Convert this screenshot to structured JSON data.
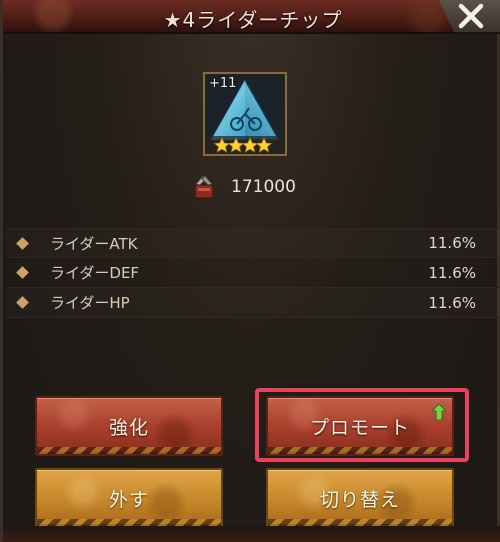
{
  "dialog": {
    "title": "★4ライダーチップ",
    "close_icon": "close-x-icon"
  },
  "item": {
    "level_badge": "+11",
    "stars": 4,
    "icon": "triangle-chip-icon"
  },
  "cost": {
    "icon": "parts-icon",
    "value": "171000"
  },
  "stats": [
    {
      "label": "ライダーATK",
      "value": "11.6%"
    },
    {
      "label": "ライダーDEF",
      "value": "11.6%"
    },
    {
      "label": "ライダーHP",
      "value": "11.6%"
    }
  ],
  "buttons": {
    "enhance": "強化",
    "promote": "プロモート",
    "remove": "外す",
    "switch": "切り替え"
  },
  "colors": {
    "highlight": "#e8425e",
    "red_button": "#a9402c",
    "gold_button": "#c6862a",
    "promote_arrow": "#7bd24a"
  }
}
